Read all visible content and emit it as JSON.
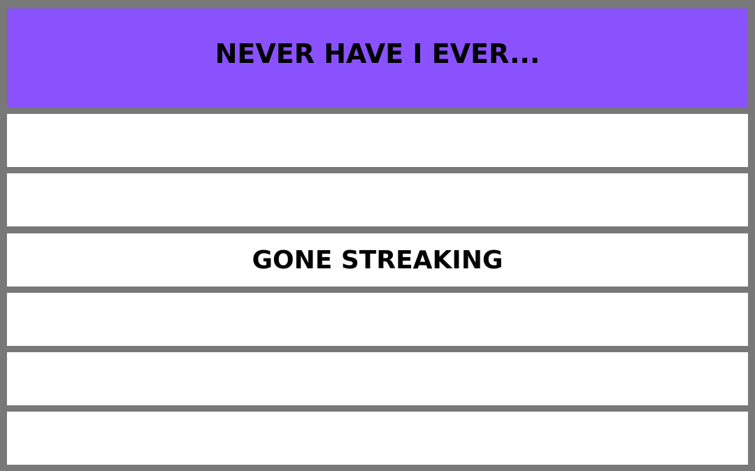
{
  "colors": {
    "header_bg": "#8a52ff",
    "border": "#787878",
    "row_bg": "#ffffff",
    "text": "#000000"
  },
  "header": {
    "title": "NEVER HAVE I EVER..."
  },
  "rows": [
    {
      "text": ""
    },
    {
      "text": ""
    },
    {
      "text": "GONE STREAKING"
    },
    {
      "text": ""
    },
    {
      "text": ""
    },
    {
      "text": ""
    }
  ]
}
